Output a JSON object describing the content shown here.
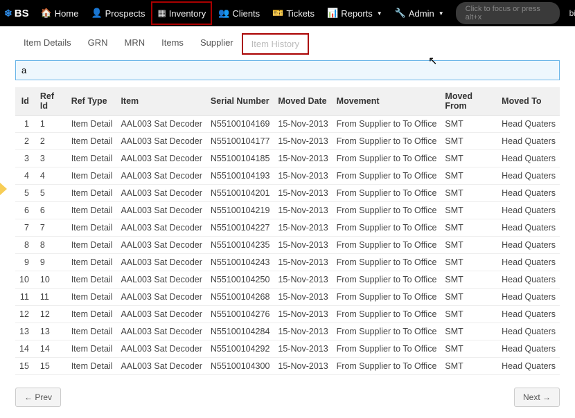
{
  "brand": {
    "icon": "❄",
    "text": "BS"
  },
  "nav": {
    "home": "Home",
    "prospects": "Prospects",
    "inventory": "Inventory",
    "clients": "Clients",
    "tickets": "Tickets",
    "reports": "Reports",
    "admin": "Admin"
  },
  "search_placeholder": "Click to focus or press alt+x",
  "user": "billing",
  "tabs": {
    "item_details": "Item Details",
    "grn": "GRN",
    "mrn": "MRN",
    "items": "Items",
    "supplier": "Supplier",
    "item_history": "Item History"
  },
  "filter_value": "a",
  "columns": [
    "Id",
    "Ref Id",
    "Ref Type",
    "Item",
    "Serial Number",
    "Moved Date",
    "Movement",
    "Moved From",
    "Moved To"
  ],
  "rows": [
    {
      "id": "1",
      "ref": "1",
      "type": "Item Detail",
      "item": "AAL003 Sat Decoder",
      "serial": "N55100104169",
      "date": "15-Nov-2013",
      "movement": "From Supplier to To Office",
      "from": "SMT",
      "to": "Head Quaters"
    },
    {
      "id": "2",
      "ref": "2",
      "type": "Item Detail",
      "item": "AAL003 Sat Decoder",
      "serial": "N55100104177",
      "date": "15-Nov-2013",
      "movement": "From Supplier to To Office",
      "from": "SMT",
      "to": "Head Quaters"
    },
    {
      "id": "3",
      "ref": "3",
      "type": "Item Detail",
      "item": "AAL003 Sat Decoder",
      "serial": "N55100104185",
      "date": "15-Nov-2013",
      "movement": "From Supplier to To Office",
      "from": "SMT",
      "to": "Head Quaters"
    },
    {
      "id": "4",
      "ref": "4",
      "type": "Item Detail",
      "item": "AAL003 Sat Decoder",
      "serial": "N55100104193",
      "date": "15-Nov-2013",
      "movement": "From Supplier to To Office",
      "from": "SMT",
      "to": "Head Quaters"
    },
    {
      "id": "5",
      "ref": "5",
      "type": "Item Detail",
      "item": "AAL003 Sat Decoder",
      "serial": "N55100104201",
      "date": "15-Nov-2013",
      "movement": "From Supplier to To Office",
      "from": "SMT",
      "to": "Head Quaters"
    },
    {
      "id": "6",
      "ref": "6",
      "type": "Item Detail",
      "item": "AAL003 Sat Decoder",
      "serial": "N55100104219",
      "date": "15-Nov-2013",
      "movement": "From Supplier to To Office",
      "from": "SMT",
      "to": "Head Quaters"
    },
    {
      "id": "7",
      "ref": "7",
      "type": "Item Detail",
      "item": "AAL003 Sat Decoder",
      "serial": "N55100104227",
      "date": "15-Nov-2013",
      "movement": "From Supplier to To Office",
      "from": "SMT",
      "to": "Head Quaters"
    },
    {
      "id": "8",
      "ref": "8",
      "type": "Item Detail",
      "item": "AAL003 Sat Decoder",
      "serial": "N55100104235",
      "date": "15-Nov-2013",
      "movement": "From Supplier to To Office",
      "from": "SMT",
      "to": "Head Quaters"
    },
    {
      "id": "9",
      "ref": "9",
      "type": "Item Detail",
      "item": "AAL003 Sat Decoder",
      "serial": "N55100104243",
      "date": "15-Nov-2013",
      "movement": "From Supplier to To Office",
      "from": "SMT",
      "to": "Head Quaters"
    },
    {
      "id": "10",
      "ref": "10",
      "type": "Item Detail",
      "item": "AAL003 Sat Decoder",
      "serial": "N55100104250",
      "date": "15-Nov-2013",
      "movement": "From Supplier to To Office",
      "from": "SMT",
      "to": "Head Quaters"
    },
    {
      "id": "11",
      "ref": "11",
      "type": "Item Detail",
      "item": "AAL003 Sat Decoder",
      "serial": "N55100104268",
      "date": "15-Nov-2013",
      "movement": "From Supplier to To Office",
      "from": "SMT",
      "to": "Head Quaters"
    },
    {
      "id": "12",
      "ref": "12",
      "type": "Item Detail",
      "item": "AAL003 Sat Decoder",
      "serial": "N55100104276",
      "date": "15-Nov-2013",
      "movement": "From Supplier to To Office",
      "from": "SMT",
      "to": "Head Quaters"
    },
    {
      "id": "13",
      "ref": "13",
      "type": "Item Detail",
      "item": "AAL003 Sat Decoder",
      "serial": "N55100104284",
      "date": "15-Nov-2013",
      "movement": "From Supplier to To Office",
      "from": "SMT",
      "to": "Head Quaters"
    },
    {
      "id": "14",
      "ref": "14",
      "type": "Item Detail",
      "item": "AAL003 Sat Decoder",
      "serial": "N55100104292",
      "date": "15-Nov-2013",
      "movement": "From Supplier to To Office",
      "from": "SMT",
      "to": "Head Quaters"
    },
    {
      "id": "15",
      "ref": "15",
      "type": "Item Detail",
      "item": "AAL003 Sat Decoder",
      "serial": "N55100104300",
      "date": "15-Nov-2013",
      "movement": "From Supplier to To Office",
      "from": "SMT",
      "to": "Head Quaters"
    }
  ],
  "pager": {
    "prev": "← Prev",
    "next": "Next →"
  }
}
